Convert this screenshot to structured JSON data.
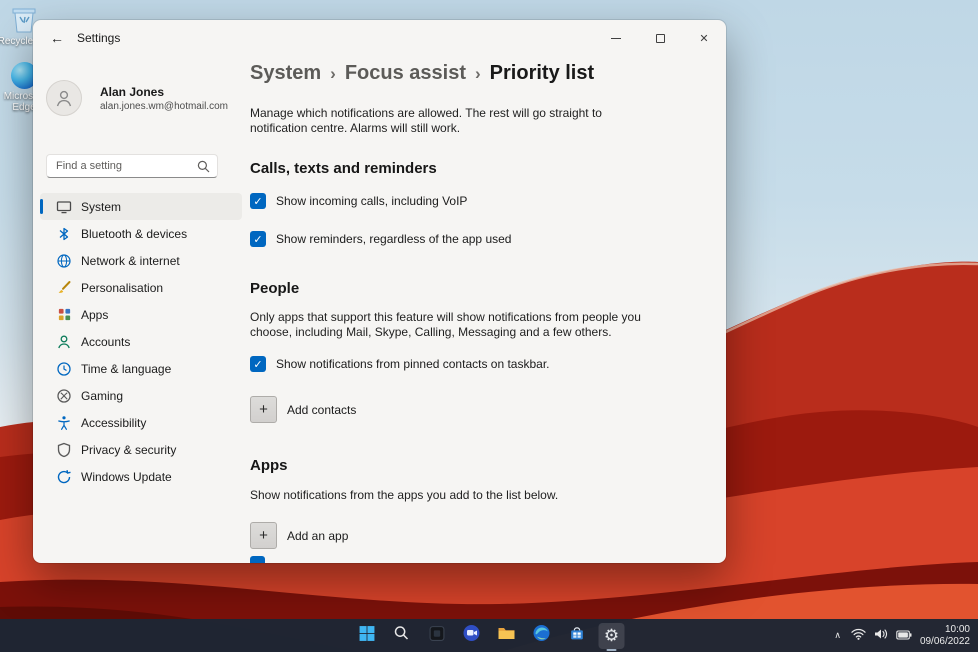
{
  "desktop": {
    "icons": [
      {
        "label": "Recycle Bin"
      },
      {
        "label": "Microsoft Edge"
      }
    ]
  },
  "glyphs": {
    "back": "←",
    "close": "✕",
    "check": "✓",
    "separator": "›",
    "plus": "+",
    "gear": "⚙",
    "tray_chevron": "∧"
  },
  "window": {
    "title": "Settings",
    "profile": {
      "name": "Alan Jones",
      "email": "alan.jones.wm@hotmail.com"
    },
    "search": {
      "placeholder": "Find a setting"
    },
    "nav": [
      {
        "label": "System",
        "selected": true
      },
      {
        "label": "Bluetooth & devices",
        "selected": false
      },
      {
        "label": "Network & internet",
        "selected": false
      },
      {
        "label": "Personalisation",
        "selected": false
      },
      {
        "label": "Apps",
        "selected": false
      },
      {
        "label": "Accounts",
        "selected": false
      },
      {
        "label": "Time & language",
        "selected": false
      },
      {
        "label": "Gaming",
        "selected": false
      },
      {
        "label": "Accessibility",
        "selected": false
      },
      {
        "label": "Privacy & security",
        "selected": false
      },
      {
        "label": "Windows Update",
        "selected": false
      }
    ],
    "breadcrumb": {
      "items": [
        {
          "label": "System"
        },
        {
          "label": "Focus assist"
        },
        {
          "label": "Priority list"
        }
      ]
    },
    "intro": "Manage which notifications are allowed. The rest will go straight to notification centre. Alarms will still work.",
    "calls": {
      "title": "Calls, texts and reminders",
      "checkboxes": [
        {
          "label": "Show incoming calls, including VoIP",
          "checked": true
        },
        {
          "label": "Show reminders, regardless of the app used",
          "checked": true
        }
      ]
    },
    "people": {
      "title": "People",
      "description": "Only apps that support this feature will show notifications from people you choose, including Mail, Skype, Calling, Messaging and a few others.",
      "checkbox": {
        "label": "Show notifications from pinned contacts on taskbar.",
        "checked": true
      },
      "add_button": "Add contacts"
    },
    "apps": {
      "title": "Apps",
      "description": "Show notifications from the apps you add to the list below.",
      "add_button": "Add an app"
    }
  },
  "taskbar": {
    "time": "10:00",
    "date": "09/06/2022"
  },
  "colors": {
    "accent": "#0067c0"
  }
}
